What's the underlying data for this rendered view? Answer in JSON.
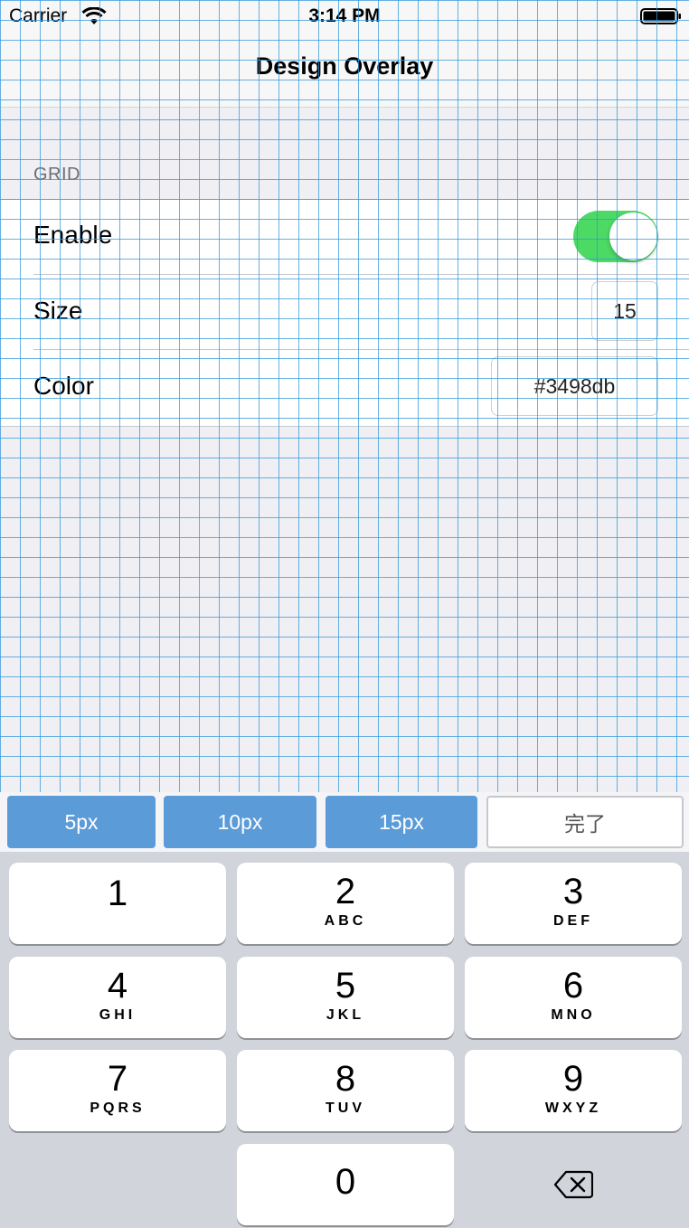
{
  "status_bar": {
    "carrier": "Carrier",
    "time": "3:14 PM"
  },
  "nav": {
    "title": "Design Overlay"
  },
  "grid_section": {
    "header": "GRID",
    "enable_label": "Enable",
    "enable_on": true,
    "size_label": "Size",
    "size_value": "15",
    "color_label": "Color",
    "color_value": "#3498db"
  },
  "accessory": {
    "buttons": [
      "5px",
      "10px",
      "15px"
    ],
    "done": "完了"
  },
  "keyboard": {
    "keys": [
      {
        "num": "1",
        "letters": ""
      },
      {
        "num": "2",
        "letters": "ABC"
      },
      {
        "num": "3",
        "letters": "DEF"
      },
      {
        "num": "4",
        "letters": "GHI"
      },
      {
        "num": "5",
        "letters": "JKL"
      },
      {
        "num": "6",
        "letters": "MNO"
      },
      {
        "num": "7",
        "letters": "PQRS"
      },
      {
        "num": "8",
        "letters": "TUV"
      },
      {
        "num": "9",
        "letters": "WXYZ"
      },
      {
        "num": "0",
        "letters": ""
      }
    ],
    "delete_icon": "backspace-icon"
  },
  "colors": {
    "grid_line": "#3498db",
    "switch_on": "#4cd964",
    "accessory_button": "#5b9bd8"
  }
}
